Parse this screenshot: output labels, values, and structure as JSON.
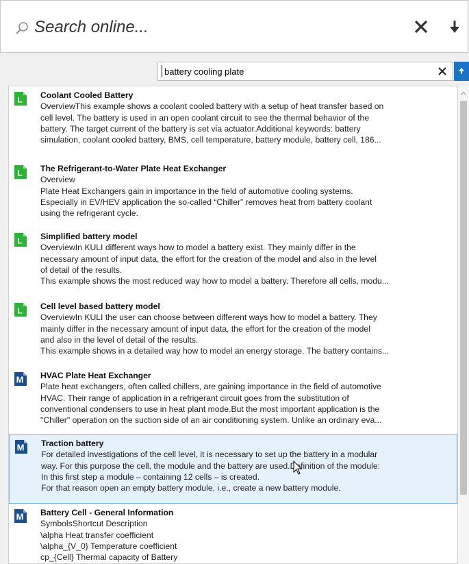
{
  "search": {
    "placeholder": "Search online...",
    "clear_icon": "close-icon",
    "download_icon": "download-arrow-icon"
  },
  "query": {
    "value": "battery cooling plate",
    "clear_icon": "close-icon",
    "submit_icon": "arrow-up-icon"
  },
  "colors": {
    "accent": "#1b73c7",
    "library_icon": "#2bb534",
    "model_icon": "#1a4f8f",
    "selected_bg": "#e5f1fb",
    "selected_border": "#7eb4ea"
  },
  "results": [
    {
      "icon": "L",
      "title": "Coolant Cooled Battery",
      "lines": [
        "OverviewThis example shows a coolant cooled battery with a setup of heat transfer based on",
        "cell level. The battery is used in an open coolant circuit to see the thermal behavior of the",
        "battery. The target current of the battery is set via actuator.Additional keywords: battery",
        "simulation, coolant cooled battery, BMS, cell temperature, battery module, battery cell, 186..."
      ]
    },
    {
      "icon": "L",
      "title": "The Refrigerant-to-Water Plate Heat Exchanger",
      "lines": [
        "Overview",
        "Plate Heat Exchangers gain in importance in the field of automotive cooling systems.",
        "Especially in EV/HEV application the so-called “Chiller”  removes heat from battery coolant",
        "using the refrigerant cycle."
      ]
    },
    {
      "icon": "L",
      "title": "Simplified battery model",
      "lines": [
        "OverviewIn KULI different ways how to model a battery exist. They mainly differ in the",
        "necessary amount of input data, the effort for the creation of the model and also in the level",
        "of detail of the results.",
        "This example shows the most reduced way how to model a battery. Therefore all cells, modu..."
      ]
    },
    {
      "icon": "L",
      "title": "Cell level based battery model",
      "lines": [
        "OverviewIn KULI the user can choose between different ways how to model a battery. They",
        "mainly differ in the necessary amount of input data, the effort for the creation of the model",
        "and also in the level of detail of the results.",
        "This example shows in a detailed way how to model an energy storage. The battery contains..."
      ]
    },
    {
      "icon": "M",
      "title": "HVAC Plate Heat Exchanger",
      "lines": [
        "Plate heat exchangers, often called chillers, are gaining importance in the field of automotive",
        "HVAC. Their range of application in a refrigerant circuit goes from the substitution of",
        "conventional condensers to use in heat plant mode.But the most important application is the",
        "\"Chiller\" operation on the suction side of an air conditioning system. Unlike an ordinary eva..."
      ]
    },
    {
      "icon": "M",
      "title": "Traction battery",
      "selected": true,
      "lines": [
        "For detailed investigations of the cell level, it is necessary to set up the battery in a modular",
        "way. For this purpose the cell, the module and the battery are used.Definition of the module:",
        "In this first step a module – containing 12 cells – is created.",
        "For that reason open an empty battery module, i.e., create a new battery module."
      ]
    },
    {
      "icon": "M",
      "title": "Battery Cell - General Information",
      "lines": [
        "SymbolsShortcut          Description",
        "\\alpha          Heat transfer coefficient",
        "\\alpha_{V_0}    Temperature coefficient",
        "cp_{Cell}        Thermal capacity of Battery"
      ]
    }
  ]
}
